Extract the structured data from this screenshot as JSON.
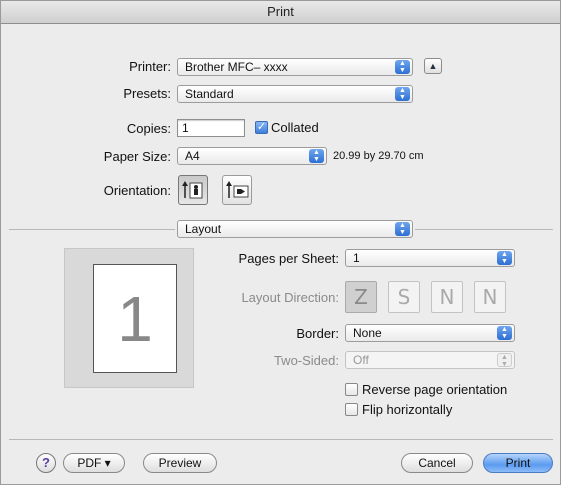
{
  "window": {
    "title": "Print"
  },
  "printer": {
    "label": "Printer:",
    "value": "Brother MFC– xxxx"
  },
  "presets": {
    "label": "Presets:",
    "value": "Standard"
  },
  "copies": {
    "label": "Copies:",
    "value": "1",
    "collated_label": "Collated",
    "collated_checked": true
  },
  "paper_size": {
    "label": "Paper Size:",
    "value": "A4",
    "dimensions": "20.99 by 29.70 cm"
  },
  "orientation": {
    "label": "Orientation:",
    "selected": "portrait"
  },
  "section": {
    "value": "Layout"
  },
  "preview": {
    "page_number": "1"
  },
  "layout": {
    "pages_per_sheet_label": "Pages per Sheet:",
    "pages_per_sheet_value": "1",
    "layout_direction_label": "Layout Direction:",
    "directions": [
      "Z",
      "S",
      "N",
      "N"
    ],
    "border_label": "Border:",
    "border_value": "None",
    "two_sided_label": "Two-Sided:",
    "two_sided_value": "Off",
    "reverse_label": "Reverse page orientation",
    "reverse_checked": false,
    "flip_label": "Flip horizontally",
    "flip_checked": false
  },
  "footer": {
    "help_glyph": "?",
    "pdf_label": "PDF ▾",
    "preview_label": "Preview",
    "cancel_label": "Cancel",
    "print_label": "Print"
  },
  "colors": {
    "accent": "#3a7ee0",
    "window_bg": "#ececec"
  }
}
